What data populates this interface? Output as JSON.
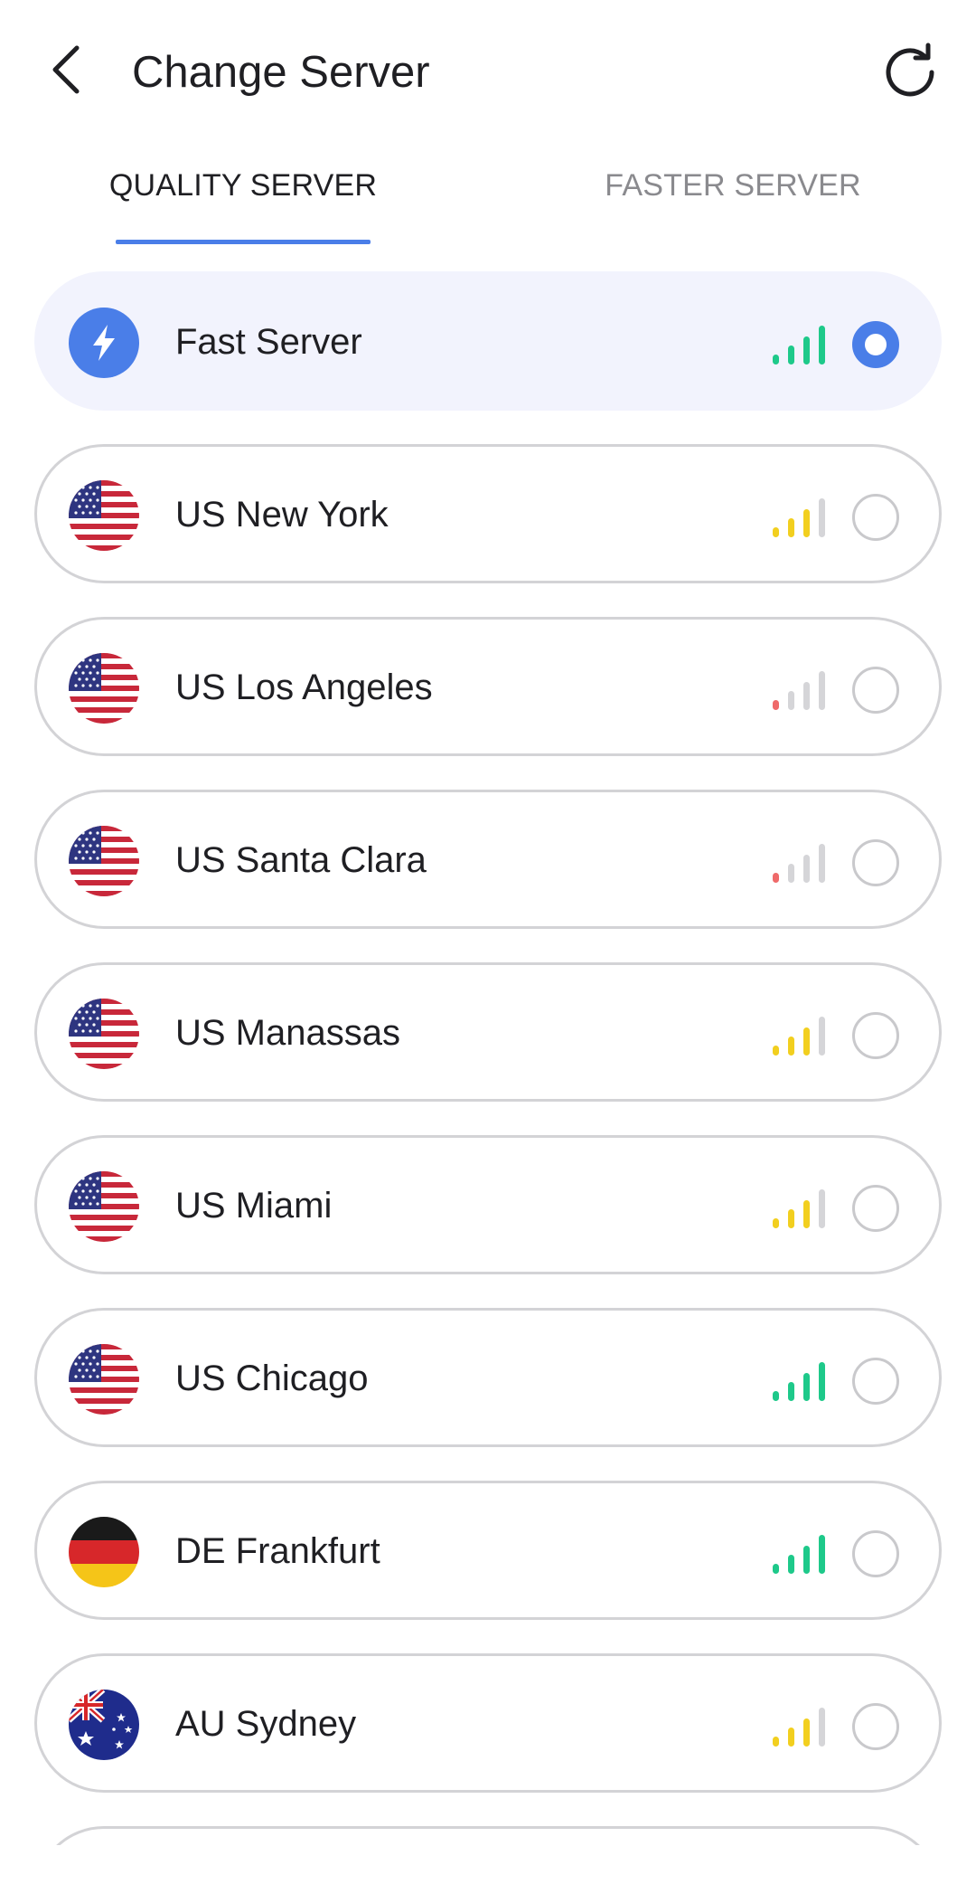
{
  "header": {
    "title": "Change Server",
    "back_icon": "chevron-left-icon",
    "refresh_icon": "refresh-icon"
  },
  "tabs": [
    {
      "label": "QUALITY SERVER",
      "active": true
    },
    {
      "label": "FASTER SERVER",
      "active": false
    }
  ],
  "colors": {
    "accent": "#4a7ee8",
    "signal_strong": "#1ec98a",
    "signal_medium": "#f2cf1f",
    "signal_weak": "#ef6a6a",
    "signal_off": "#d5d5d8",
    "selected_bg": "#f2f3fd",
    "border": "#d3d3d6"
  },
  "servers": [
    {
      "name": "Fast Server",
      "icon": "lightning-bolt-icon",
      "signal_bars": 4,
      "signal_level": "strong",
      "selected": true
    },
    {
      "name": "US New York",
      "icon": "us-flag-icon",
      "signal_bars": 3,
      "signal_level": "medium",
      "selected": false
    },
    {
      "name": "US Los Angeles",
      "icon": "us-flag-icon",
      "signal_bars": 1,
      "signal_level": "weak",
      "selected": false
    },
    {
      "name": "US Santa Clara",
      "icon": "us-flag-icon",
      "signal_bars": 1,
      "signal_level": "weak",
      "selected": false
    },
    {
      "name": "US Manassas",
      "icon": "us-flag-icon",
      "signal_bars": 3,
      "signal_level": "medium",
      "selected": false
    },
    {
      "name": "US Miami",
      "icon": "us-flag-icon",
      "signal_bars": 3,
      "signal_level": "medium",
      "selected": false
    },
    {
      "name": "US Chicago",
      "icon": "us-flag-icon",
      "signal_bars": 4,
      "signal_level": "strong",
      "selected": false
    },
    {
      "name": "DE Frankfurt",
      "icon": "de-flag-icon",
      "signal_bars": 4,
      "signal_level": "strong",
      "selected": false
    },
    {
      "name": "AU Sydney",
      "icon": "au-flag-icon",
      "signal_bars": 3,
      "signal_level": "medium",
      "selected": false
    },
    {
      "name": "",
      "icon": "",
      "signal_bars": 0,
      "signal_level": "off",
      "selected": false
    }
  ]
}
